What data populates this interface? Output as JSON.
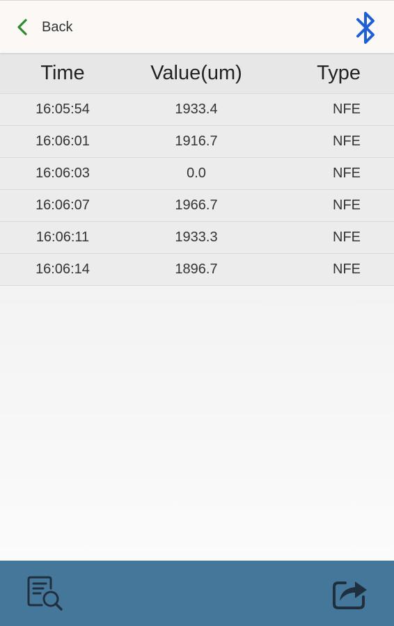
{
  "header": {
    "back_label": "Back",
    "back_icon": "chevron-left-icon",
    "bluetooth_icon": "bluetooth-icon",
    "accent_back": "#2e8b2e",
    "accent_bluetooth": "#1f5fd6"
  },
  "table": {
    "columns": [
      "Time",
      "Value(um)",
      "Type"
    ],
    "rows": [
      {
        "time": "16:05:54",
        "value": "1933.4",
        "type": "NFE"
      },
      {
        "time": "16:06:01",
        "value": "1916.7",
        "type": "NFE"
      },
      {
        "time": "16:06:03",
        "value": "0.0",
        "type": "NFE"
      },
      {
        "time": "16:06:07",
        "value": "1966.7",
        "type": "NFE"
      },
      {
        "time": "16:06:11",
        "value": "1933.3",
        "type": "NFE"
      },
      {
        "time": "16:06:14",
        "value": "1896.7",
        "type": "NFE"
      }
    ]
  },
  "footer": {
    "left_icon": "document-search-icon",
    "right_icon": "share-icon",
    "background": "#45779b"
  }
}
